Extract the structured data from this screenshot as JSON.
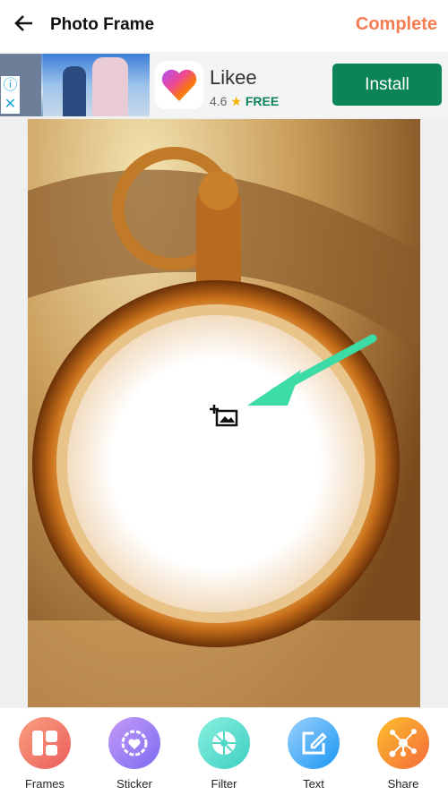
{
  "header": {
    "title": "Photo Frame",
    "complete_label": "Complete",
    "back_icon": "arrow-left-icon"
  },
  "ad": {
    "app_name": "Likee",
    "rating": "4.6",
    "price": "FREE",
    "install_label": "Install",
    "colors": {
      "install": "#0b8457"
    }
  },
  "canvas": {
    "add_photo_icon": "add-photo-icon",
    "arrow_color": "#3ddba6"
  },
  "toolbar": {
    "items": [
      {
        "label": "Frames",
        "icon": "frames-icon",
        "color": "#f07a6a"
      },
      {
        "label": "Sticker",
        "icon": "sticker-icon",
        "color": "#9d7cf0"
      },
      {
        "label": "Filter",
        "icon": "aperture-icon",
        "color": "#4fd8c8"
      },
      {
        "label": "Text",
        "icon": "edit-icon",
        "color": "#3aa6f7"
      },
      {
        "label": "Share",
        "icon": "share-icon",
        "color": "#f7853a"
      }
    ]
  },
  "colors": {
    "accent": "#f47c50"
  }
}
